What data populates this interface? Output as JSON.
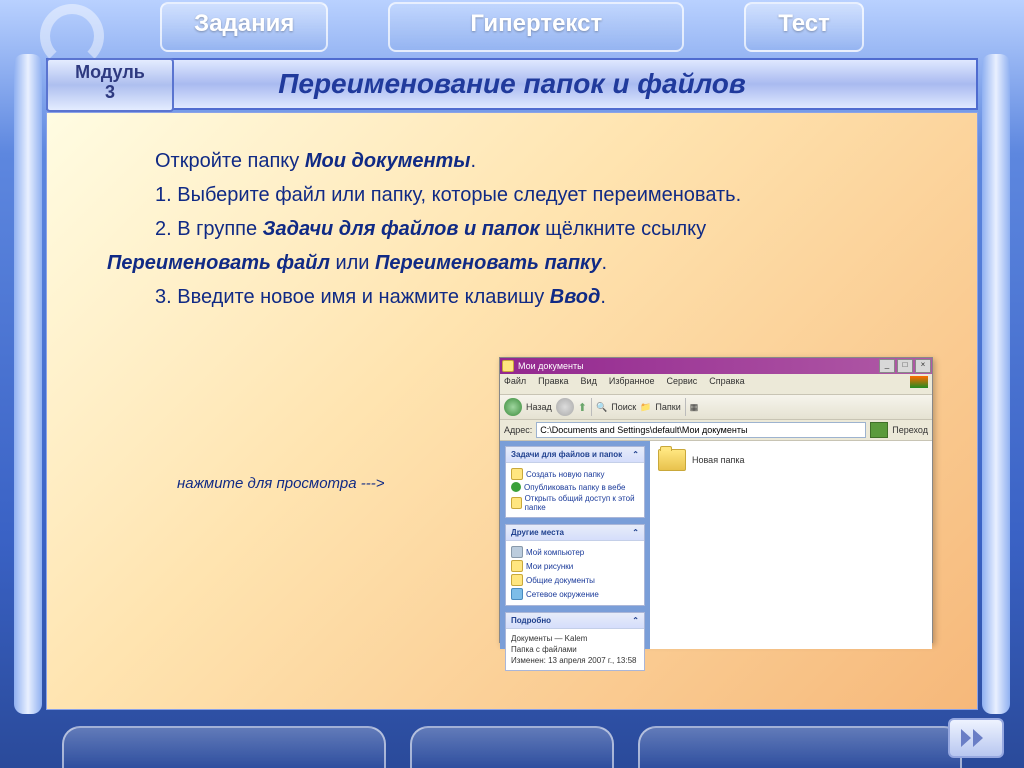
{
  "tabs": {
    "left": "Задания",
    "center": "Гипертекст",
    "right": "Тест"
  },
  "module": {
    "line1": "Модуль",
    "line2": "3"
  },
  "title": "Переименование папок и файлов",
  "body": {
    "intro_plain": "Откройте папку ",
    "intro_em": "Мои документы",
    "s1": "1. Выберите файл или папку, которые следует переименовать.",
    "s2a": "2. В группе ",
    "s2em1": "Задачи для файлов и папок ",
    "s2b": "щёлкните ссылку",
    "s2em2": "Переименовать файл ",
    "s2c": "или ",
    "s2em3": "Переименовать папку",
    "s3a": "3. Введите новое имя и нажмите клавишу ",
    "s3em": "Ввод"
  },
  "caption": "нажмите для просмотра --->",
  "win": {
    "title": "Мои документы",
    "menu": [
      "Файл",
      "Правка",
      "Вид",
      "Избранное",
      "Сервис",
      "Справка"
    ],
    "tool": {
      "back": "Назад",
      "search": "Поиск",
      "folders": "Папки"
    },
    "addr_label": "Адрес:",
    "addr_value": "C:\\Documents and Settings\\default\\Мои документы",
    "go": "Переход",
    "panels": {
      "tasks": {
        "h": "Задачи для файлов и папок",
        "i": [
          "Создать новую папку",
          "Опубликовать папку в вебе",
          "Открыть общий доступ к этой папке"
        ]
      },
      "places": {
        "h": "Другие места",
        "i": [
          "Мой компьютер",
          "Мои рисунки",
          "Общие документы",
          "Сетевое окружение"
        ]
      },
      "details": {
        "h": "Подробно",
        "l1": "Документы — Kalem",
        "l2": "Папка с файлами",
        "l3": "Изменен: 13 апреля 2007 г., 13:58"
      }
    },
    "folder_name": "Новая папка"
  }
}
